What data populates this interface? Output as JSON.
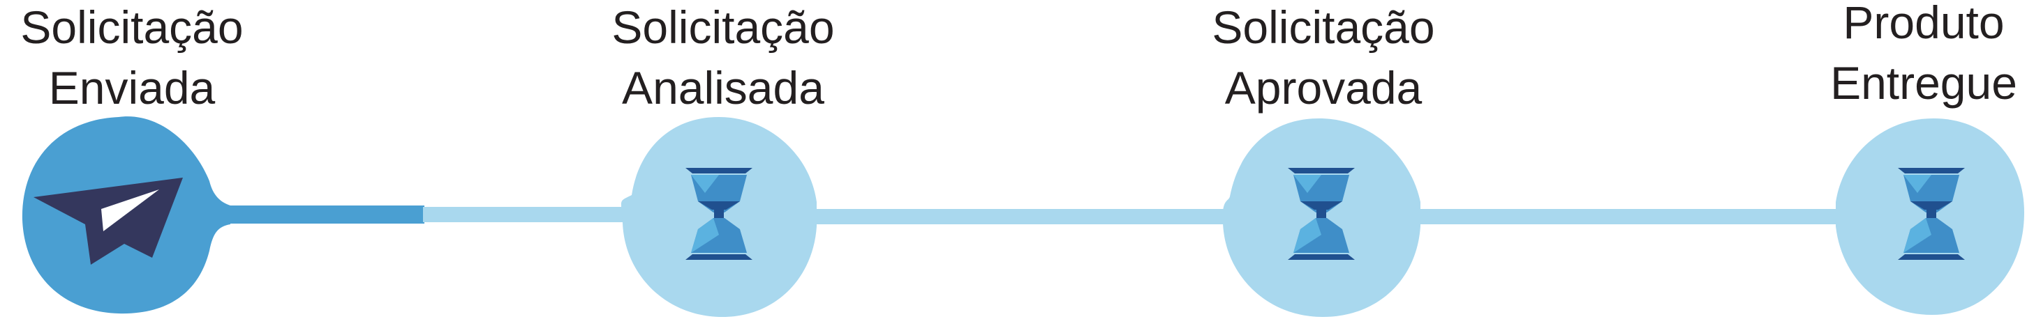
{
  "steps": [
    {
      "label": "Solicitação\nEnviada",
      "status": "complete",
      "icon": "paper-plane-icon"
    },
    {
      "label": "Solicitação\nAnalisada",
      "status": "pending",
      "icon": "hourglass-icon"
    },
    {
      "label": "Solicitação\nAprovada",
      "status": "pending",
      "icon": "hourglass-icon"
    },
    {
      "label": "Produto\nEntregue",
      "status": "pending",
      "icon": "hourglass-icon"
    }
  ],
  "colors": {
    "complete": "#4a9fd2",
    "pending": "#a9d8ee",
    "plane": "#34375d",
    "hourglass_dark": "#20508f",
    "hourglass_mid": "#3f8ec8",
    "hourglass_light": "#5bb2e0",
    "text": "#231f20"
  }
}
